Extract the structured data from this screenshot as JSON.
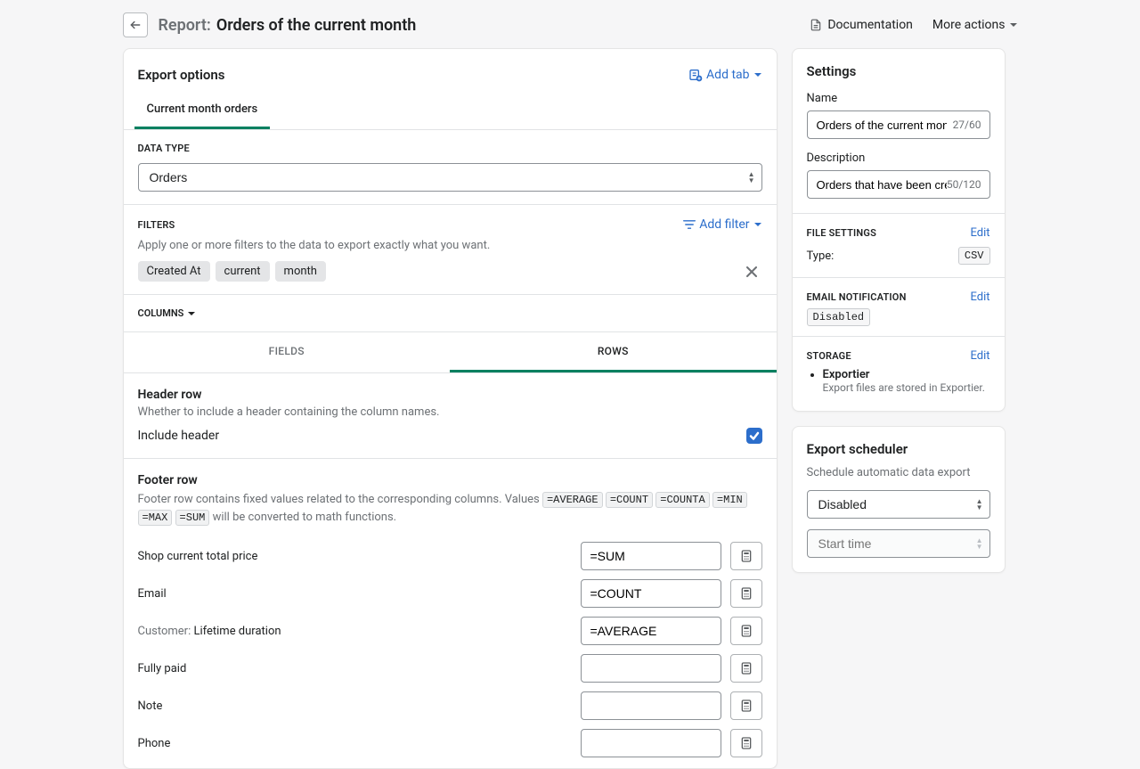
{
  "header": {
    "title_prefix": "Report:",
    "title_name": "Orders of the current month",
    "documentation_label": "Documentation",
    "more_actions_label": "More actions"
  },
  "export_options": {
    "title": "Export options",
    "add_tab_label": "Add tab",
    "tabs": [
      "Current month orders"
    ],
    "data_type_label": "DATA TYPE",
    "data_type_value": "Orders",
    "filters_label": "FILTERS",
    "add_filter_label": "Add filter",
    "filters_desc": "Apply one or more filters to the data to export exactly what you want.",
    "filter_chips": [
      "Created At",
      "current",
      "month"
    ],
    "columns_label": "COLUMNS",
    "inner_tabs": {
      "fields": "FIELDS",
      "rows": "ROWS"
    },
    "header_row": {
      "title": "Header row",
      "desc": "Whether to include a header containing the column names.",
      "include_label": "Include header",
      "checked": true
    },
    "footer_row": {
      "title": "Footer row",
      "desc_prefix": "Footer row contains fixed values related to the corresponding columns. Values ",
      "funcs": [
        "=AVERAGE",
        "=COUNT",
        "=COUNTA",
        "=MIN",
        "=MAX",
        "=SUM"
      ],
      "desc_suffix": " will be converted to math functions.",
      "rows": [
        {
          "label_prefix": "",
          "label": "Shop current total price",
          "value": "=SUM"
        },
        {
          "label_prefix": "",
          "label": "Email",
          "value": "=COUNT"
        },
        {
          "label_prefix": "Customer: ",
          "label": "Lifetime duration",
          "value": "=AVERAGE"
        },
        {
          "label_prefix": "",
          "label": "Fully paid",
          "value": ""
        },
        {
          "label_prefix": "",
          "label": "Note",
          "value": ""
        },
        {
          "label_prefix": "",
          "label": "Phone",
          "value": ""
        }
      ]
    }
  },
  "settings": {
    "title": "Settings",
    "name_label": "Name",
    "name_value": "Orders of the current month",
    "name_count": "27/60",
    "description_label": "Description",
    "description_value": "Orders that have been create",
    "description_count": "50/120",
    "file_settings_label": "FILE SETTINGS",
    "edit_label": "Edit",
    "type_label": "Type:",
    "type_value": "CSV",
    "email_label": "EMAIL NOTIFICATION",
    "email_value": "Disabled",
    "storage_label": "STORAGE",
    "storage_item": "Exportier",
    "storage_sub": "Export files are stored in Exportier."
  },
  "scheduler": {
    "title": "Export scheduler",
    "desc": "Schedule automatic data export",
    "state_value": "Disabled",
    "start_placeholder": "Start time"
  }
}
